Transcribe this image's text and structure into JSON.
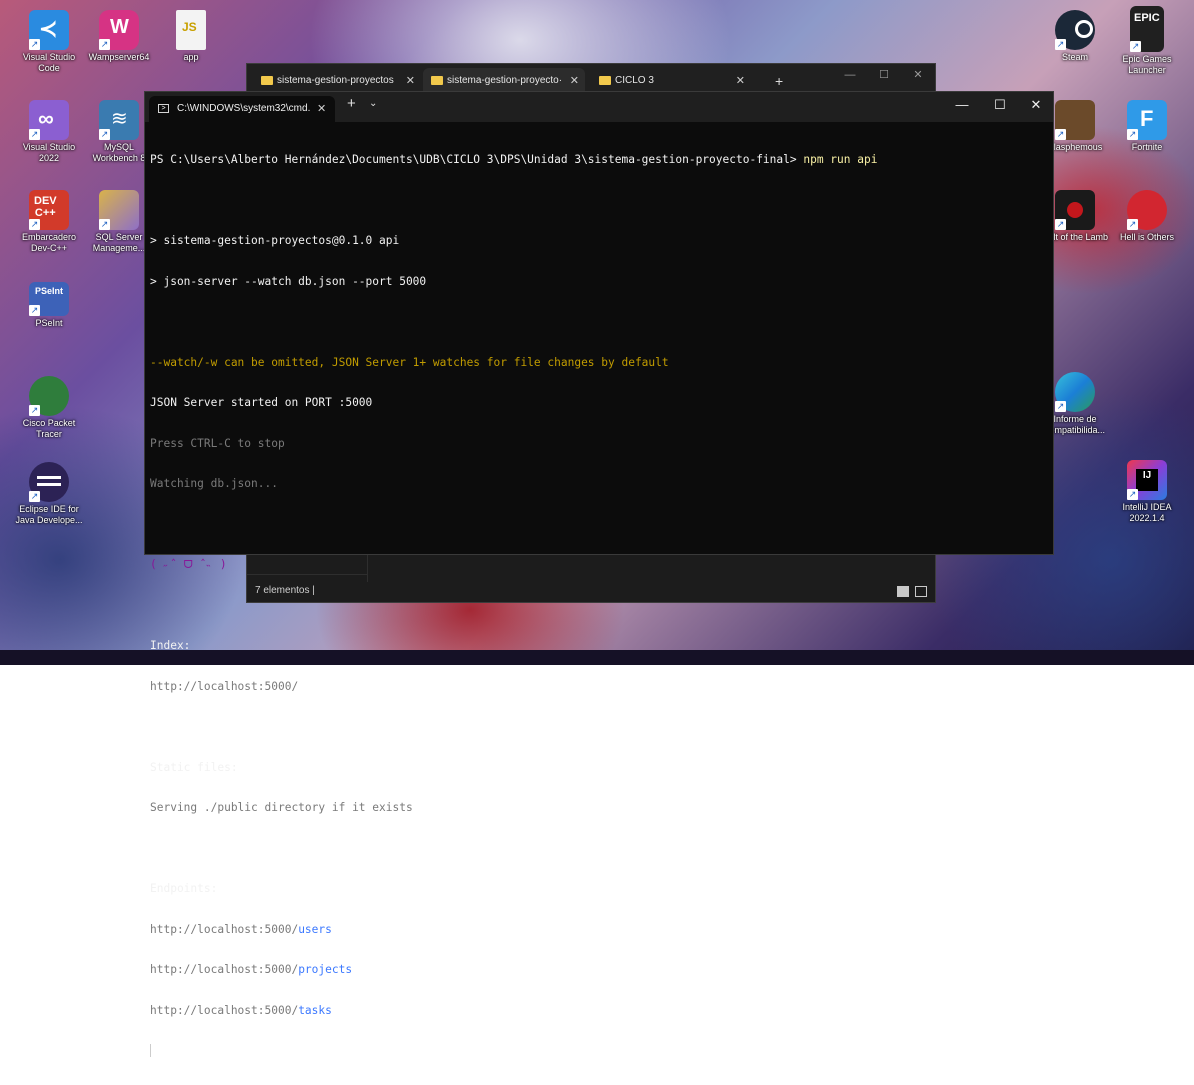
{
  "desktop": {
    "icons_left": [
      {
        "label": "Visual Studio Code",
        "icon": "vscode-icon",
        "color": "#2a8be0"
      },
      {
        "label": "Wampserver64",
        "icon": "wampserver-icon",
        "color": "#d63384"
      },
      {
        "label": "app",
        "icon": "js-file-icon",
        "color": "#f3f3f3"
      },
      {
        "label": "Visual Studio 2022",
        "icon": "visual-studio-icon",
        "color": "#8b5fd1"
      },
      {
        "label": "MySQL Workbench 8",
        "icon": "mysql-workbench-icon",
        "color": "#3a7bb0"
      },
      {
        "label": "Embarcadero Dev-C++",
        "icon": "devcpp-icon",
        "color": "#d23a2a"
      },
      {
        "label": "SQL Server Manageme...",
        "icon": "sql-server-icon",
        "color": "#d9b34a"
      },
      {
        "label": "PSeInt",
        "icon": "pseint-icon",
        "color": "#3d62b8"
      },
      {
        "label": "Cisco Packet Tracer",
        "icon": "cisco-packet-tracer-icon",
        "color": "#2f7d3c"
      },
      {
        "label": "Eclipse IDE for Java Develope...",
        "icon": "eclipse-icon",
        "color": "#2c2255"
      }
    ],
    "icons_right": [
      {
        "label": "Steam",
        "icon": "steam-icon",
        "color": "#1b2838"
      },
      {
        "label": "Epic Games Launcher",
        "icon": "epic-games-icon",
        "color": "#202020"
      },
      {
        "label": "Blasphemous",
        "icon": "blasphemous-icon",
        "color": "#6b4a2a"
      },
      {
        "label": "Fortnite",
        "icon": "fortnite-icon",
        "color": "#2f9ae8"
      },
      {
        "label": "Cult of the Lamb",
        "icon": "cult-of-the-lamb-icon",
        "color": "#1a1a1a"
      },
      {
        "label": "Hell is Others",
        "icon": "hell-is-others-icon",
        "color": "#d22630"
      },
      {
        "label": "Informe de compatibilida...",
        "icon": "edge-icon",
        "color": "#1b7fd6"
      },
      {
        "label": "IntelliJ IDEA 2022.1.4",
        "icon": "intellij-icon",
        "color": "#8a3ed8"
      }
    ],
    "js_badge": "JS",
    "dev_badge": "DEV\nC++",
    "epic_badge": "EPIC",
    "ij_badge": "IJ",
    "fortnite_badge": "F"
  },
  "explorer": {
    "tabs": [
      {
        "label": "sistema-gestion-proyectos",
        "close": "✕"
      },
      {
        "label": "sistema-gestion-proyecto·",
        "close": "✕"
      },
      {
        "label": "CICLO 3",
        "close": "✕"
      }
    ],
    "new_tab": "+",
    "status": "7 elementos  |",
    "controls": {
      "minimize": "—",
      "maximize": "☐",
      "close": "✕"
    }
  },
  "terminal": {
    "tab_title": "C:\\WINDOWS\\system32\\cmd.",
    "tab_close": "✕",
    "new_tab": "+",
    "dropdown": "⌄",
    "controls": {
      "minimize": "—",
      "maximize": "☐",
      "close": "✕"
    },
    "prompt": "PS C:\\Users\\Alberto Hernández\\Documents\\UDB\\CICLO 3\\DPS\\Unidad 3\\sistema-gestion-proyecto-final> ",
    "command": "npm run api",
    "lines": {
      "script_name": "> sistema-gestion-proyectos@0.1.0 api",
      "script_cmd": "> json-server --watch db.json --port 5000",
      "watch_warning": "--watch/-w can be omitted, JSON Server 1+ watches for file changes by default",
      "started": "JSON Server started on PORT :5000",
      "stop_hint": "Press CTRL-C to stop",
      "watching": "Watching db.json...",
      "emoticon": "( ˶ˆ ᗜ ˆ˵ )",
      "index_title": "Index:",
      "index_url": "http://localhost:5000/",
      "static_title": "Static files:",
      "static_desc": "Serving ./public directory if it exists",
      "endpoints_title": "Endpoints:",
      "endpoint_base": "http://localhost:5000/",
      "endpoints": [
        "users",
        "projects",
        "tasks"
      ]
    },
    "colors": {
      "background": "#0c0c0c",
      "warning": "#c19c00",
      "endpoint": "#3b78ff",
      "emoticon": "#881798"
    }
  }
}
